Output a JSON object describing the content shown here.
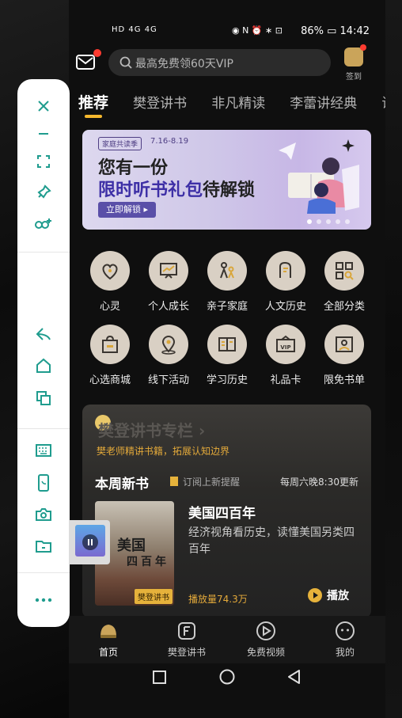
{
  "status": {
    "left_icons": "HD 4G 4G",
    "mid_icons": "◉ N ⏰ ∗ ⊡",
    "battery": "86%",
    "time": "14:42"
  },
  "top": {
    "search_placeholder": "最高免费领60天VIP",
    "checkin_label": "签到"
  },
  "tabs": [
    "推荐",
    "樊登讲书",
    "非凡精读",
    "李蕾讲经典",
    "课"
  ],
  "banner": {
    "tag": "家庭共读季",
    "date": "7.16-8.19",
    "line1": "您有一份",
    "line2_highlight": "限时听书礼包",
    "line2_rest": "待解锁",
    "button": "立即解锁 ▸"
  },
  "categories": [
    {
      "label": "心灵",
      "icon": "heart-lock-icon"
    },
    {
      "label": "个人成长",
      "icon": "growth-chart-icon"
    },
    {
      "label": "亲子家庭",
      "icon": "family-icon"
    },
    {
      "label": "人文历史",
      "icon": "history-icon"
    },
    {
      "label": "全部分类",
      "icon": "all-categories-icon"
    },
    {
      "label": "心选商城",
      "icon": "shopping-bag-icon"
    },
    {
      "label": "线下活动",
      "icon": "location-icon"
    },
    {
      "label": "学习历史",
      "icon": "study-history-icon"
    },
    {
      "label": "礼品卡",
      "icon": "vip-card-icon"
    },
    {
      "label": "限免书单",
      "icon": "free-booklist-icon"
    }
  ],
  "column": {
    "title": "樊登讲书专栏 ›",
    "subtitle": "樊老师精讲书籍，拓展认知边界",
    "week_label": "本周新书",
    "remind": "订阅上新提醒",
    "update": "每周六晚8:30更新",
    "cover_title1": "美国",
    "cover_title2": "四百年",
    "cover_badge": "樊登讲书",
    "book_title": "美国四百年",
    "book_desc": "经济视角看历史，读懂美国另类四百年",
    "plays": "播放量74.3万",
    "play_button": "播放"
  },
  "tabbar": [
    "首页",
    "樊登讲书",
    "免费视频",
    "我的"
  ],
  "colors": {
    "accent": "#f5b82e",
    "sidebar_icon": "#1f9c8e"
  }
}
